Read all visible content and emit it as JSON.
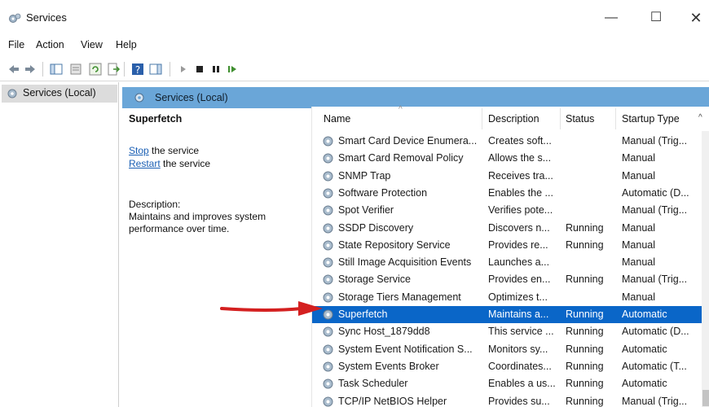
{
  "window": {
    "title": "Services",
    "minimize_glyph": "—",
    "maximize_glyph": "☐",
    "close_glyph": "✕",
    "app_icon": "gear-icon"
  },
  "menu": [
    "File",
    "Action",
    "View",
    "Help"
  ],
  "toolbar": {
    "buttons": [
      "back-icon",
      "forward-icon",
      "show-hide-console-tree-icon",
      "properties-icon",
      "refresh-icon",
      "export-list-icon",
      "help-icon",
      "show-hide-action-pane-icon",
      "start-icon",
      "stop-icon",
      "pause-icon",
      "restart-icon"
    ]
  },
  "tree": {
    "selected": "Services (Local)"
  },
  "pane": {
    "header": "Services (Local)",
    "header_color": "#6aa6d8"
  },
  "details": {
    "service_name": "Superfetch",
    "stop_link": "Stop",
    "stop_suffix": " the service",
    "restart_link": "Restart",
    "restart_suffix": " the service",
    "description_label": "Description:",
    "description_text": "Maintains and improves system performance over time."
  },
  "list": {
    "columns": [
      "Name",
      "Description",
      "Status",
      "Startup Type"
    ],
    "selected_color": "#0a66c8",
    "rows": [
      {
        "name": "Smart Card Device Enumera...",
        "description": "Creates soft...",
        "status": "",
        "startup": "Manual (Trig..."
      },
      {
        "name": "Smart Card Removal Policy",
        "description": "Allows the s...",
        "status": "",
        "startup": "Manual"
      },
      {
        "name": "SNMP Trap",
        "description": "Receives tra...",
        "status": "",
        "startup": "Manual"
      },
      {
        "name": "Software Protection",
        "description": "Enables the ...",
        "status": "",
        "startup": "Automatic (D..."
      },
      {
        "name": "Spot Verifier",
        "description": "Verifies pote...",
        "status": "",
        "startup": "Manual (Trig..."
      },
      {
        "name": "SSDP Discovery",
        "description": "Discovers n...",
        "status": "Running",
        "startup": "Manual"
      },
      {
        "name": "State Repository Service",
        "description": "Provides re...",
        "status": "Running",
        "startup": "Manual"
      },
      {
        "name": "Still Image Acquisition Events",
        "description": "Launches a...",
        "status": "",
        "startup": "Manual"
      },
      {
        "name": "Storage Service",
        "description": "Provides en...",
        "status": "Running",
        "startup": "Manual (Trig..."
      },
      {
        "name": "Storage Tiers Management",
        "description": "Optimizes t...",
        "status": "",
        "startup": "Manual"
      },
      {
        "name": "Superfetch",
        "description": "Maintains a...",
        "status": "Running",
        "startup": "Automatic",
        "selected": true
      },
      {
        "name": "Sync Host_1879dd8",
        "description": "This service ...",
        "status": "Running",
        "startup": "Automatic (D..."
      },
      {
        "name": "System Event Notification S...",
        "description": "Monitors sy...",
        "status": "Running",
        "startup": "Automatic"
      },
      {
        "name": "System Events Broker",
        "description": "Coordinates...",
        "status": "Running",
        "startup": "Automatic (T..."
      },
      {
        "name": "Task Scheduler",
        "description": "Enables a us...",
        "status": "Running",
        "startup": "Automatic"
      },
      {
        "name": "TCP/IP NetBIOS Helper",
        "description": "Provides su...",
        "status": "Running",
        "startup": "Manual (Trig..."
      }
    ]
  },
  "annotation": {
    "arrow_color": "#d42020",
    "points_to": "Superfetch"
  }
}
